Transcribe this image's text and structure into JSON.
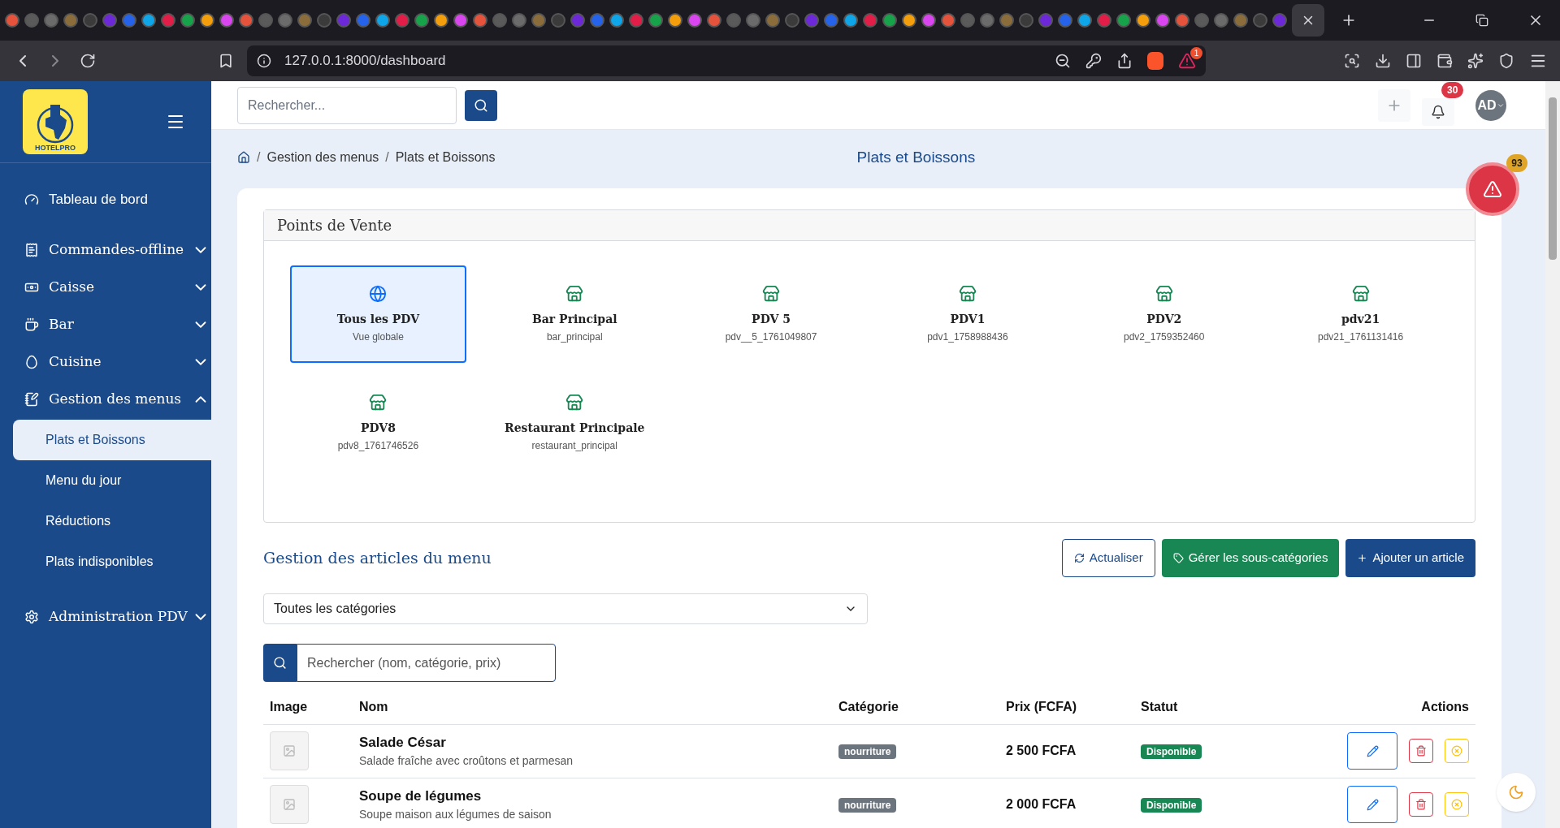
{
  "browser": {
    "url": "127.0.0.1:8000/dashboard",
    "extension_badge": "1"
  },
  "sidebar": {
    "logo_text": "HOTELPRO",
    "items": [
      {
        "label": "Tableau de bord",
        "kind": "link"
      },
      {
        "label": "Commandes-offline",
        "kind": "group",
        "expanded": false
      },
      {
        "label": "Caisse",
        "kind": "group",
        "expanded": false
      },
      {
        "label": "Bar",
        "kind": "group",
        "expanded": false
      },
      {
        "label": "Cuisine",
        "kind": "group",
        "expanded": false
      },
      {
        "label": "Gestion des menus",
        "kind": "group",
        "expanded": true,
        "children": [
          {
            "label": "Plats et Boissons",
            "selected": true
          },
          {
            "label": "Menu du jour",
            "selected": false
          },
          {
            "label": "Réductions",
            "selected": false
          },
          {
            "label": "Plats indisponibles",
            "selected": false
          }
        ]
      },
      {
        "label": "Administration PDV",
        "kind": "group",
        "expanded": false
      }
    ]
  },
  "header": {
    "search_placeholder": "Rechercher...",
    "notification_count": "30",
    "avatar": "AD"
  },
  "breadcrumb": {
    "separator": "/",
    "items": [
      "Gestion des menus",
      "Plats et Boissons"
    ]
  },
  "page_title": "Plats et Boissons",
  "alert_count": "93",
  "points_de_vente": {
    "title": "Points de Vente",
    "items": [
      {
        "name": "Tous les PDV",
        "code": "Vue globale",
        "kind": "global",
        "selected": true
      },
      {
        "name": "Bar Principal",
        "code": "bar_principal",
        "kind": "store",
        "selected": false
      },
      {
        "name": "PDV 5",
        "code": "pdv__5_1761049807",
        "kind": "store",
        "selected": false
      },
      {
        "name": "PDV1",
        "code": "pdv1_1758988436",
        "kind": "store",
        "selected": false
      },
      {
        "name": "PDV2",
        "code": "pdv2_1759352460",
        "kind": "store",
        "selected": false
      },
      {
        "name": "pdv21",
        "code": "pdv21_1761131416",
        "kind": "store",
        "selected": false
      },
      {
        "name": "PDV8",
        "code": "pdv8_1761746526",
        "kind": "store",
        "selected": false
      },
      {
        "name": "Restaurant Principale",
        "code": "restaurant_principal",
        "kind": "store",
        "selected": false
      }
    ]
  },
  "articles": {
    "title": "Gestion des articles du menu",
    "buttons": [
      {
        "label": "Actualiser",
        "kind": "refresh"
      },
      {
        "label": "Gérer les sous-catégories",
        "kind": "tags"
      },
      {
        "label": "Ajouter un article",
        "kind": "add"
      }
    ],
    "category_select": "Toutes les catégories",
    "search_placeholder": "Rechercher (nom, catégorie, prix)",
    "columns": [
      "Image",
      "Nom",
      "Catégorie",
      "Prix (FCFA)",
      "Statut",
      "Actions"
    ],
    "rows": [
      {
        "name": "Salade César",
        "description": "Salade fraîche avec croûtons et parmesan",
        "category": "nourriture",
        "price": "2 500 FCFA",
        "status": "Disponible"
      },
      {
        "name": "Soupe de légumes",
        "description": "Soupe maison aux légumes de saison",
        "category": "nourriture",
        "price": "2 000 FCFA",
        "status": "Disponible"
      }
    ]
  }
}
